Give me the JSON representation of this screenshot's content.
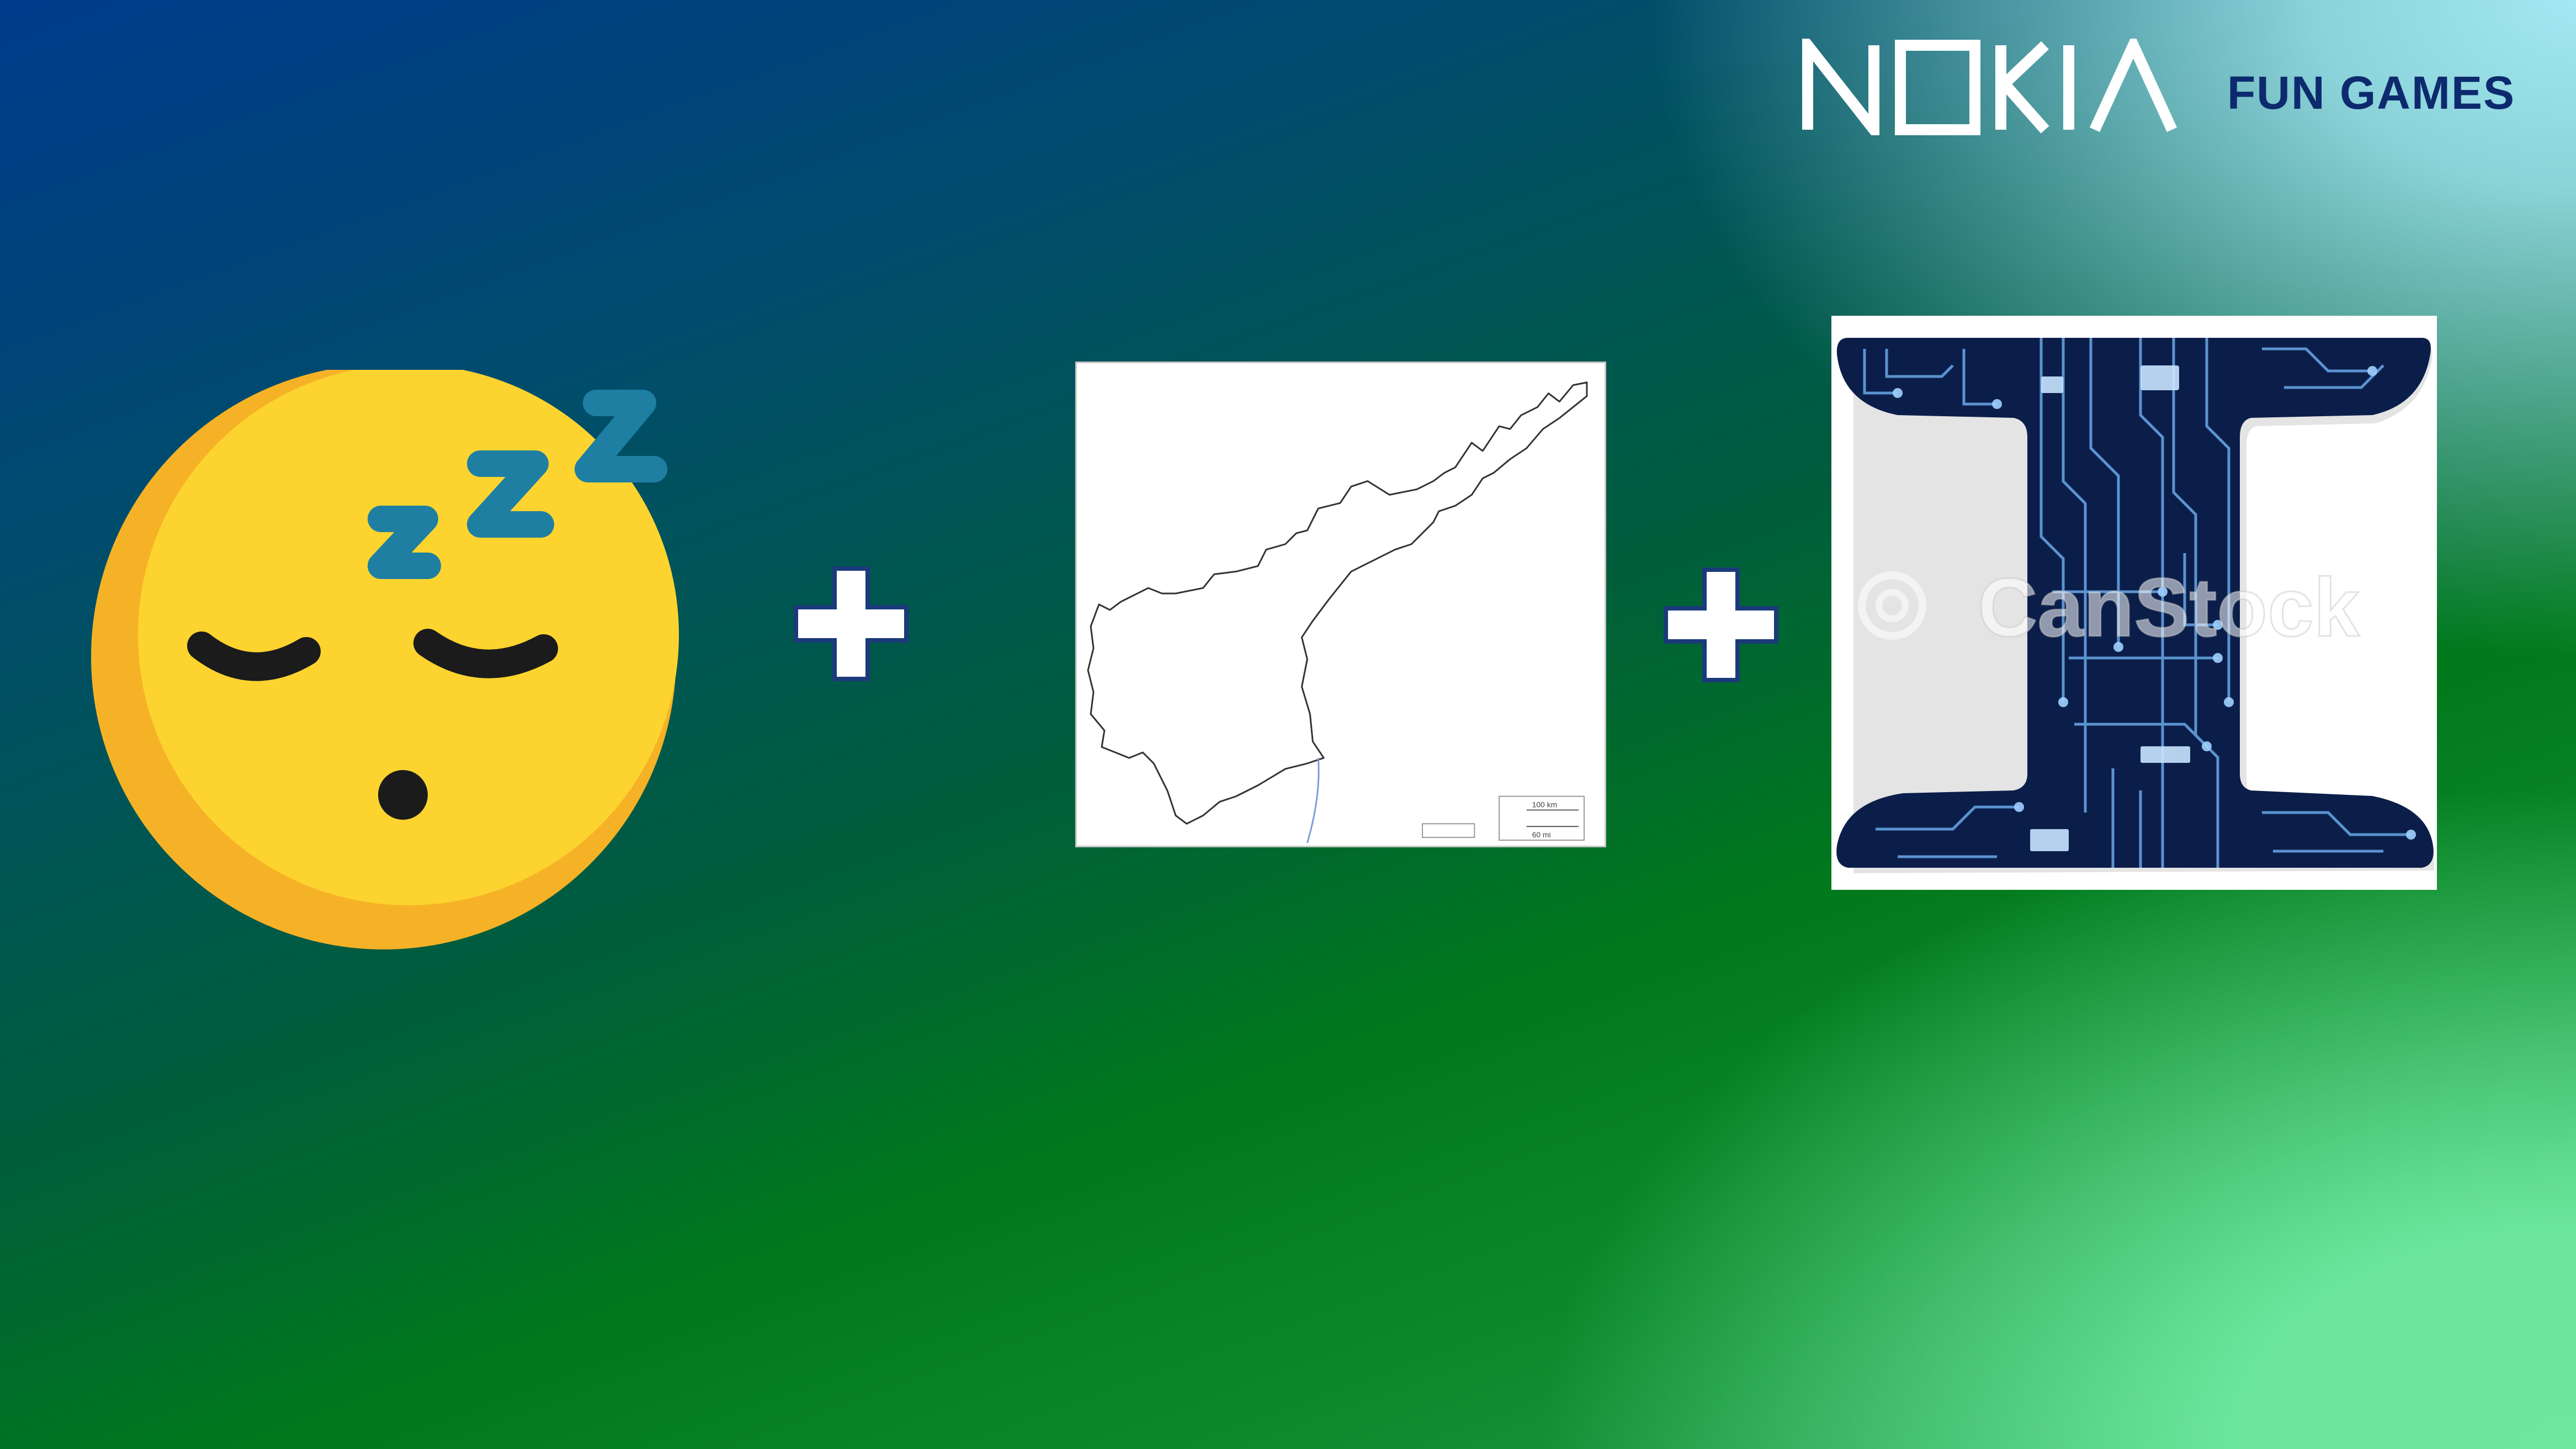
{
  "header": {
    "brand": "NOKIA",
    "subtitle": "FUN GAMES"
  },
  "puzzle": {
    "pieces": [
      {
        "name": "sleeping-face-emoji-icon"
      },
      {
        "name": "plus-icon"
      },
      {
        "name": "state-outline-map-image"
      },
      {
        "name": "plus-icon"
      },
      {
        "name": "circuit-letter-i-image"
      }
    ],
    "map_scale_lines": [
      "100 km",
      "60 mi"
    ],
    "circuit_watermark": "CanStock"
  },
  "colors": {
    "emoji_face": "#fdd42f",
    "emoji_shadow": "#f6b226",
    "zzz": "#1e7fa3",
    "plus_fill": "#ffffff",
    "plus_outline": "#1a3a7a",
    "circuit_bg": "#0b1e4a",
    "logo_white": "#ffffff",
    "subtitle_navy": "#0d2a6e"
  }
}
